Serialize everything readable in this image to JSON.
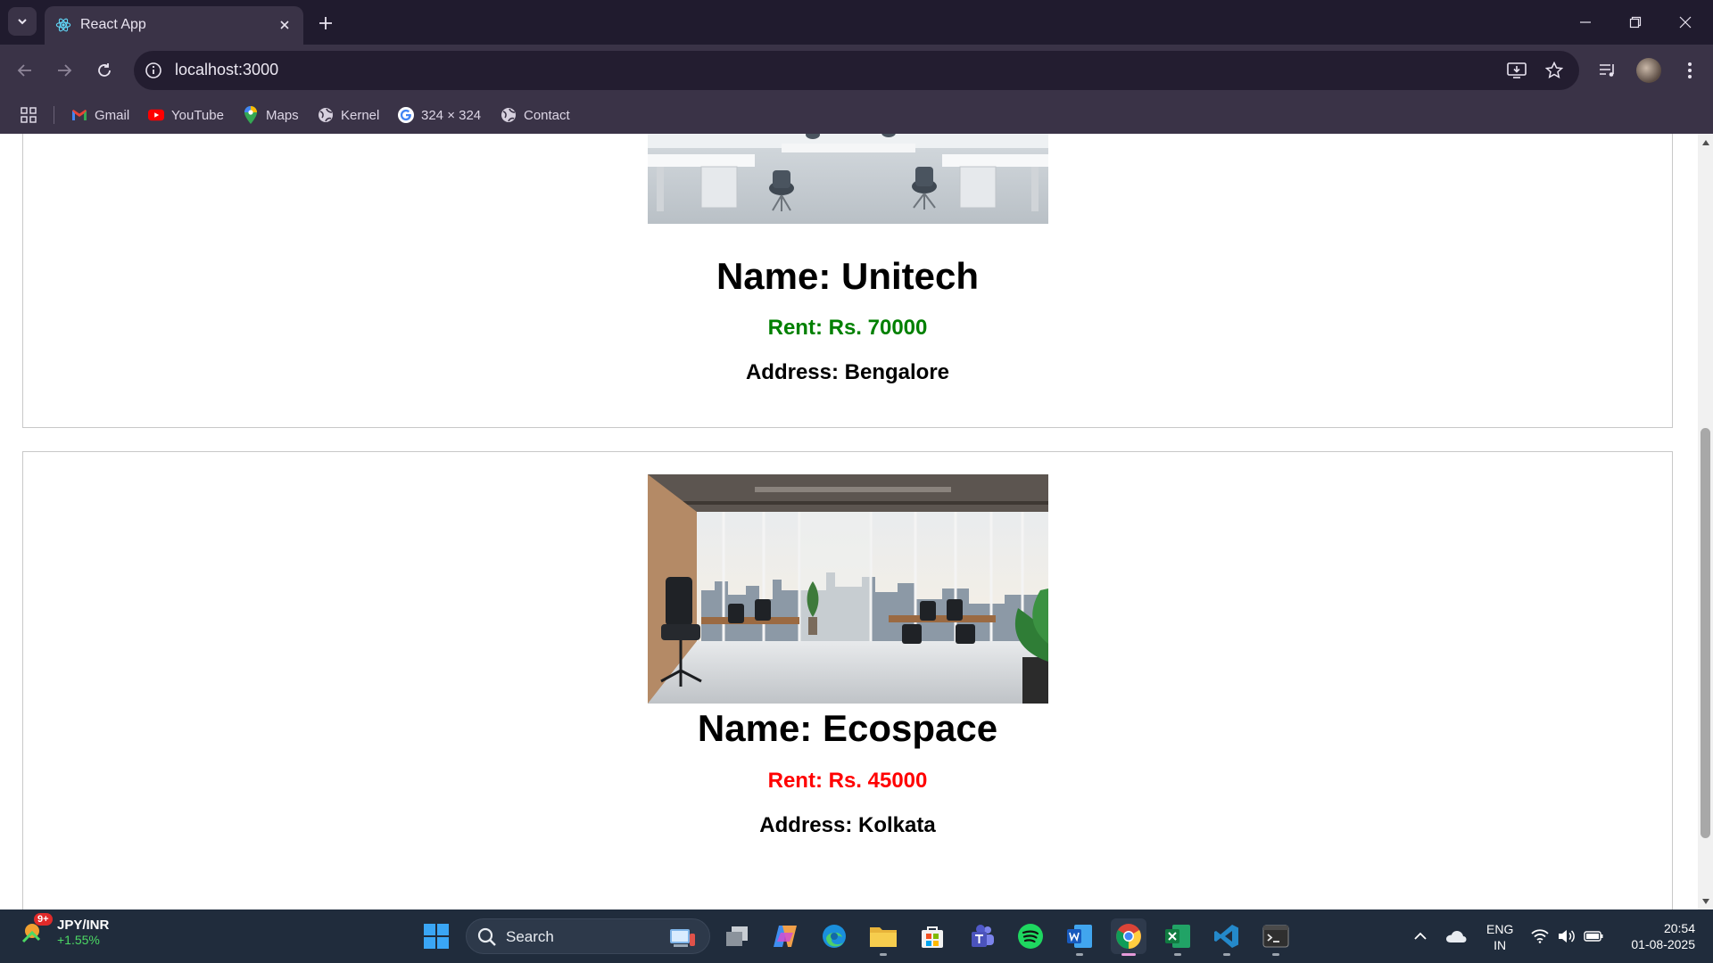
{
  "browser": {
    "tab_title": "React App",
    "url": "localhost:3000",
    "bookmarks": [
      {
        "label": "Gmail",
        "icon": "gmail-icon"
      },
      {
        "label": "YouTube",
        "icon": "youtube-icon"
      },
      {
        "label": "Maps",
        "icon": "maps-icon"
      },
      {
        "label": "Kernel",
        "icon": "globe-icon"
      },
      {
        "label": "324 × 324",
        "icon": "google-icon"
      },
      {
        "label": "Contact",
        "icon": "globe-icon"
      }
    ]
  },
  "listings": [
    {
      "name": "Name: Unitech",
      "rent": "Rent: Rs. 70000",
      "address": "Address: Bengalore",
      "rent_color": "#008000"
    },
    {
      "name": "Name: Ecospace",
      "rent": "Rent: Rs. 45000",
      "address": "Address: Kolkata",
      "rent_color": "#ff0000"
    }
  ],
  "taskbar": {
    "weather_title": "JPY/INR",
    "weather_sub": "+1.55%",
    "weather_badge": "9+",
    "search_label": "Search",
    "lang_top": "ENG",
    "lang_bottom": "IN",
    "time": "20:54",
    "date": "01-08-2025"
  }
}
